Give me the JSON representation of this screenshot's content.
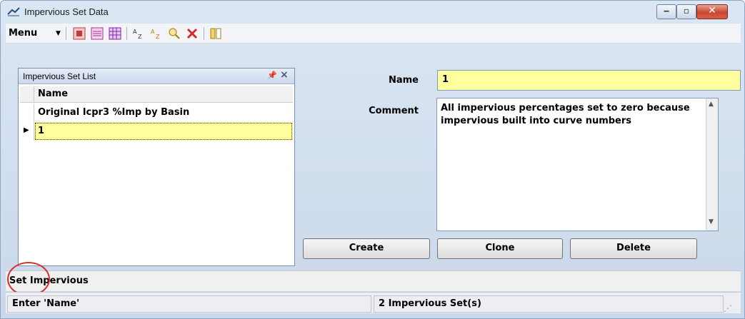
{
  "window": {
    "title": "Impervious Set Data",
    "controls": {
      "minimize": "minimize",
      "maximize": "maximize",
      "close": "close"
    }
  },
  "toolbar": {
    "menu_label": "Menu",
    "icons": [
      "add-record-icon",
      "list-view-icon",
      "grid-view-icon",
      "sort-ascending-icon",
      "sort-descending-icon",
      "find-icon",
      "clear-filter-icon",
      "columns-icon"
    ]
  },
  "list_panel": {
    "title": "Impervious Set List",
    "column_header": "Name",
    "rows": [
      {
        "name": "Original Icpr3 %Imp by Basin",
        "selected": false
      },
      {
        "name": "1",
        "selected": true
      }
    ]
  },
  "form": {
    "name_label": "Name",
    "name_value": "1",
    "comment_label": "Comment",
    "comment_value": "All impervious percentages set to zero because impervious built into curve numbers"
  },
  "buttons": {
    "create": "Create",
    "clone": "Clone",
    "delete": "Delete"
  },
  "set_bar": {
    "text": "Set Impervious"
  },
  "status": {
    "left": "Enter 'Name'",
    "right": "2 Impervious Set(s)"
  },
  "colors": {
    "highlight_yellow": "#ffff9e",
    "annotation_red": "#d53030",
    "close_button_red": "#c8472e"
  }
}
